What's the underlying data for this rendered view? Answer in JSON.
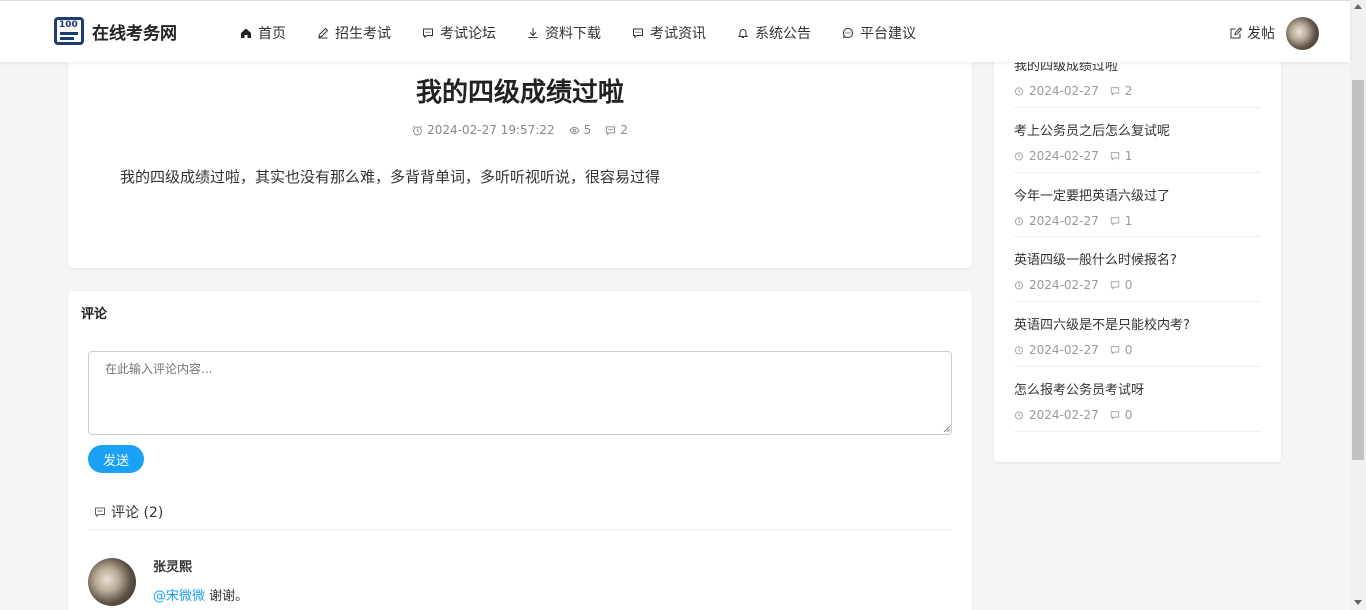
{
  "header": {
    "logo_text": "在线考务网",
    "nav": [
      {
        "label": "首页",
        "icon": "home-icon"
      },
      {
        "label": "招生考试",
        "icon": "pencil-icon"
      },
      {
        "label": "考试论坛",
        "icon": "chat-icon"
      },
      {
        "label": "资料下载",
        "icon": "download-icon"
      },
      {
        "label": "考试资讯",
        "icon": "chat-icon"
      },
      {
        "label": "系统公告",
        "icon": "bell-icon"
      },
      {
        "label": "平台建议",
        "icon": "chat-circle-icon"
      }
    ],
    "post_label": "发帖"
  },
  "article": {
    "title": "我的四级成绩过啦",
    "datetime": "2024-02-27 19:57:22",
    "views": "5",
    "comments": "2",
    "body": "我的四级成绩过啦，其实也没有那么难，多背背单词，多听听视听说，很容易过得"
  },
  "comments_section": {
    "heading": "评论",
    "placeholder": "在此输入评论内容...",
    "send_label": "发送",
    "count_label": "评论 (2)",
    "items": [
      {
        "name": "张灵熙",
        "mention": "@宋微微",
        "text": " 谢谢。"
      }
    ]
  },
  "sidebar": {
    "items": [
      {
        "title": "我的四级成绩过啦",
        "date": "2024-02-27",
        "count": "2"
      },
      {
        "title": "考上公务员之后怎么复试呢",
        "date": "2024-02-27",
        "count": "1"
      },
      {
        "title": "今年一定要把英语六级过了",
        "date": "2024-02-27",
        "count": "1"
      },
      {
        "title": "英语四级一般什么时候报名?",
        "date": "2024-02-27",
        "count": "0"
      },
      {
        "title": "英语四六级是不是只能校内考?",
        "date": "2024-02-27",
        "count": "0"
      },
      {
        "title": "怎么报考公务员考试呀",
        "date": "2024-02-27",
        "count": "0"
      }
    ]
  },
  "colors": {
    "accent": "#1aa0f4",
    "brand": "#1d3b74"
  }
}
